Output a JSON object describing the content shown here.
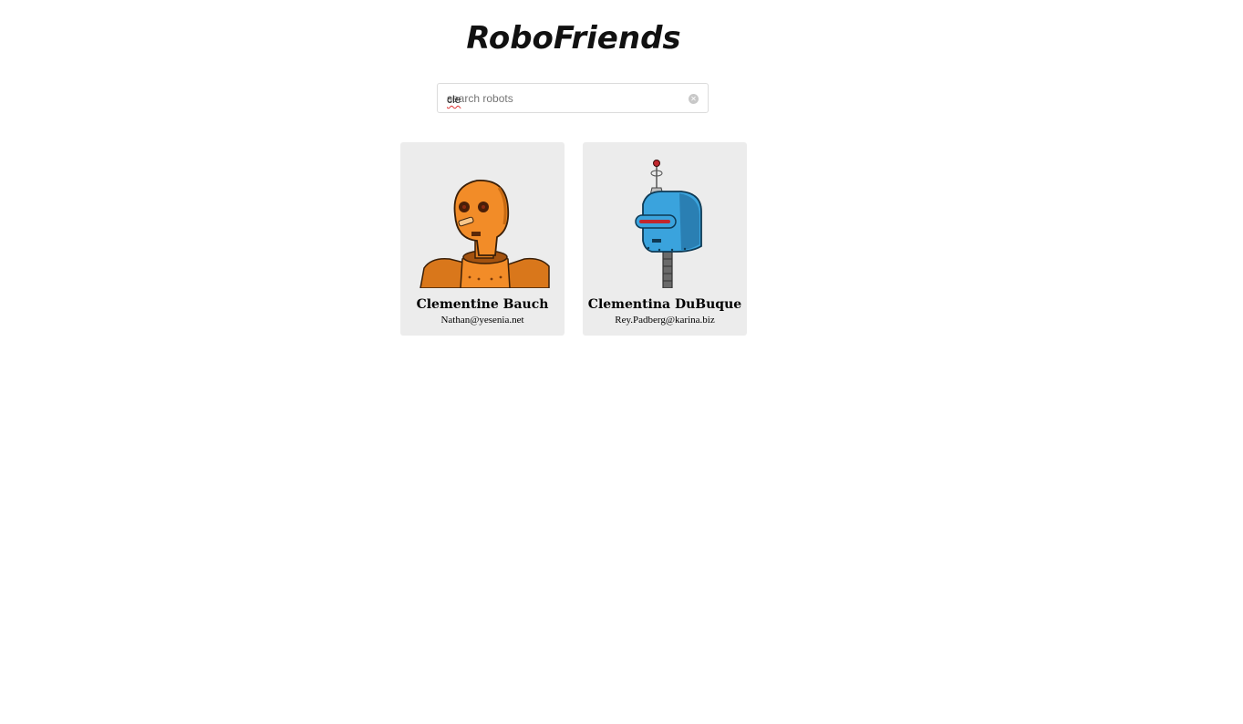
{
  "app": {
    "title": "RoboFriends"
  },
  "search": {
    "value": "cle",
    "placeholder": "search robots",
    "clear_icon": "clear-circle-icon"
  },
  "cards": [
    {
      "name": "Clementine Bauch",
      "email": "Nathan@yesenia.net",
      "image": "orange-robot-avatar"
    },
    {
      "name": "Clementina DuBuque",
      "email": "Rey.Padberg@karina.biz",
      "image": "blue-robot-avatar"
    }
  ],
  "colors": {
    "card_background": "#ececec",
    "page_background": "#ffffff",
    "orange_robot": "#f28c28",
    "blue_robot": "#3aa3dd"
  }
}
